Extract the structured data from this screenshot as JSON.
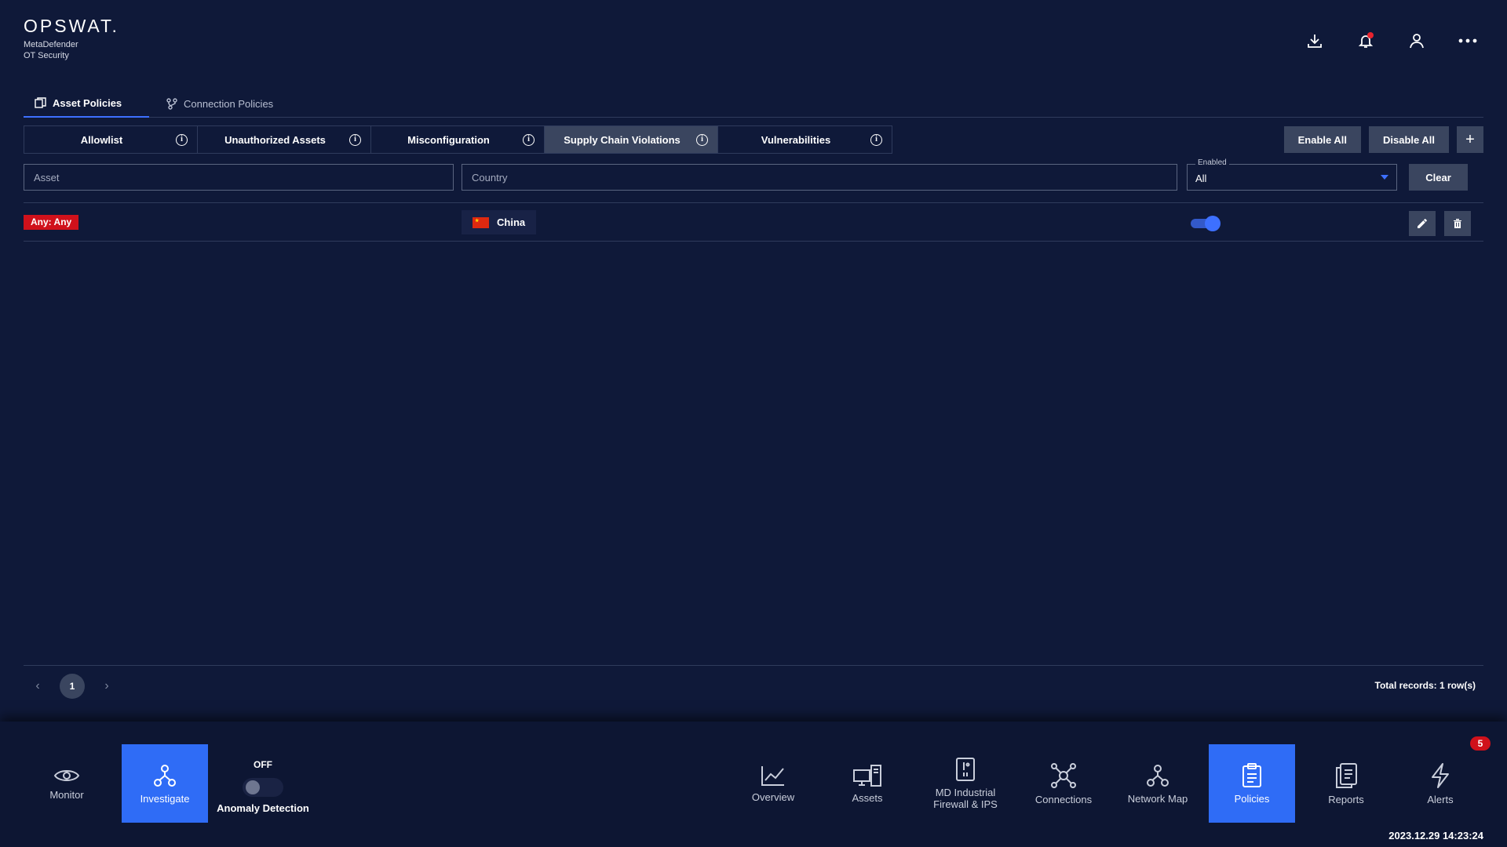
{
  "brand": {
    "name": "OPSWAT.",
    "product_line1": "MetaDefender",
    "product_line2": "OT Security"
  },
  "header_icons": [
    "download-icon",
    "bell-icon",
    "user-icon",
    "more-icon"
  ],
  "top_tabs": [
    {
      "label": "Asset Policies",
      "active": true,
      "icon": "asset-policies-icon"
    },
    {
      "label": "Connection Policies",
      "active": false,
      "icon": "connection-policies-icon"
    }
  ],
  "sub_tabs": [
    {
      "label": "Allowlist",
      "active": false
    },
    {
      "label": "Unauthorized Assets",
      "active": false
    },
    {
      "label": "Misconfiguration",
      "active": false
    },
    {
      "label": "Supply Chain Violations",
      "active": true
    },
    {
      "label": "Vulnerabilities",
      "active": false
    }
  ],
  "actions": {
    "enable_all": "Enable All",
    "disable_all": "Disable All",
    "add": "+"
  },
  "filters": {
    "asset_placeholder": "Asset",
    "country_placeholder": "Country",
    "enabled_label": "Enabled",
    "enabled_value": "All",
    "clear": "Clear"
  },
  "rows": [
    {
      "asset": "Any: Any",
      "country": "China",
      "enabled": true
    }
  ],
  "pagination": {
    "current_page": "1",
    "prev": "‹",
    "next": "›",
    "total": "Total records: 1 row(s)"
  },
  "dock": {
    "monitor": "Monitor",
    "investigate": "Investigate",
    "anomaly_state": "OFF",
    "anomaly_label": "Anomaly Detection",
    "overview": "Overview",
    "assets": "Assets",
    "firewall_line1": "MD Industrial",
    "firewall_line2": "Firewall & IPS",
    "connections": "Connections",
    "network_map": "Network Map",
    "policies": "Policies",
    "reports": "Reports",
    "alerts": "Alerts",
    "alerts_count": "5",
    "active_item": "policies",
    "active_mode": "investigate"
  },
  "timestamp": "2023.12.29 14:23:24",
  "colors": {
    "background": "#0f1939",
    "accent": "#2f6cf6",
    "danger": "#d0111b",
    "button": "#3a455f"
  }
}
